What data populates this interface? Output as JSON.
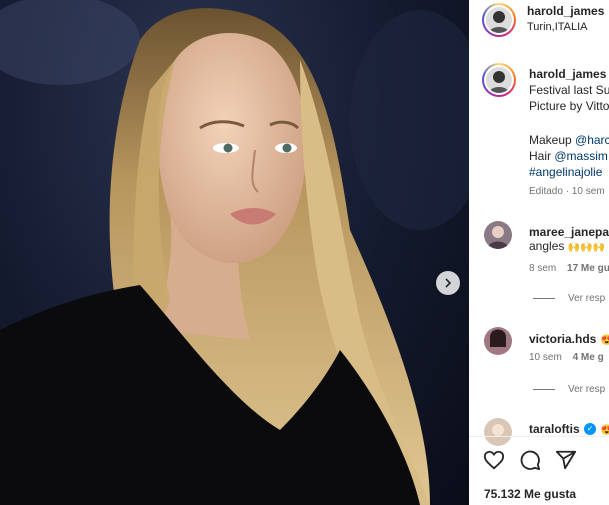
{
  "post": {
    "author": "harold_james",
    "location": "Turin,ITALIA",
    "caption_lines": [
      "Festival last Su",
      "Picture by Vitto"
    ],
    "makeup_prefix": "Makeup ",
    "makeup_handle": "@harc",
    "hair_prefix": "Hair ",
    "hair_handle": "@massim",
    "hashtag": "#angelinajolie",
    "meta": "Editado · 10 sem"
  },
  "comments": [
    {
      "user": "maree_janepa",
      "text": "angles",
      "emoji": "🙌🙌🙌",
      "age": "8 sem",
      "likes": "17 Me gu",
      "replies": "Ver resp"
    },
    {
      "user": "victoria.hds",
      "emoji": "😍",
      "age": "10 sem",
      "likes": "4 Me g",
      "replies": "Ver resp"
    },
    {
      "user": "taraloftis",
      "emoji": "😍"
    }
  ],
  "footer": {
    "likes": "75.132 Me gusta"
  },
  "icons": [
    "chevron-right-icon",
    "verified-icon",
    "heart-icon",
    "comment-icon",
    "share-icon"
  ],
  "colors": {
    "link": "#00376b",
    "muted": "#737373",
    "verified": "#0095f6"
  }
}
